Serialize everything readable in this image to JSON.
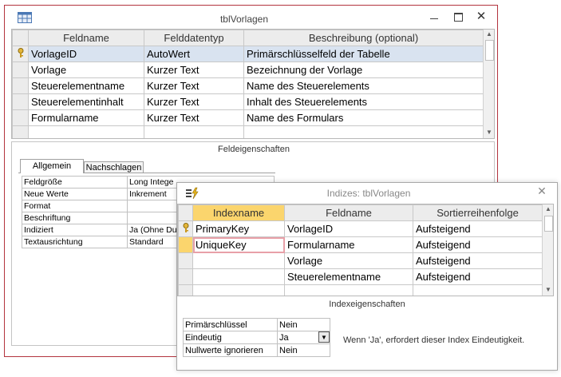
{
  "main": {
    "title": "tblVorlagen",
    "columns": [
      "Feldname",
      "Felddatentyp",
      "Beschreibung (optional)"
    ],
    "rows": [
      {
        "name": "VorlageID",
        "type": "AutoWert",
        "desc": "Primärschlüsselfeld der Tabelle"
      },
      {
        "name": "Vorlage",
        "type": "Kurzer Text",
        "desc": "Bezeichnung der Vorlage"
      },
      {
        "name": "Steuerelementname",
        "type": "Kurzer Text",
        "desc": "Name des Steuerelements"
      },
      {
        "name": "Steuerelementinhalt",
        "type": "Kurzer Text",
        "desc": "Inhalt des Steuerelements"
      },
      {
        "name": "Formularname",
        "type": "Kurzer Text",
        "desc": "Name des Formulars"
      }
    ],
    "field_props_title": "Feldeigenschaften",
    "tabs": [
      "Allgemein",
      "Nachschlagen"
    ],
    "props": [
      {
        "label": "Feldgröße",
        "value": "Long Intege"
      },
      {
        "label": "Neue Werte",
        "value": "Inkrement"
      },
      {
        "label": "Format",
        "value": ""
      },
      {
        "label": "Beschriftung",
        "value": ""
      },
      {
        "label": "Indiziert",
        "value": "Ja (Ohne Du"
      },
      {
        "label": "Textausrichtung",
        "value": "Standard"
      }
    ]
  },
  "index": {
    "title": "Indizes: tblVorlagen",
    "columns": [
      "Indexname",
      "Feldname",
      "Sortierreihenfolge"
    ],
    "rows": [
      {
        "index": "PrimaryKey",
        "field": "VorlageID",
        "order": "Aufsteigend"
      },
      {
        "index": "UniqueKey",
        "field": "Formularname",
        "order": "Aufsteigend"
      },
      {
        "index": "",
        "field": "Vorlage",
        "order": "Aufsteigend"
      },
      {
        "index": "",
        "field": "Steuerelementname",
        "order": "Aufsteigend"
      }
    ],
    "props_title": "Indexeigenschaften",
    "props": [
      {
        "label": "Primärschlüssel",
        "value": "Nein"
      },
      {
        "label": "Eindeutig",
        "value": "Ja"
      },
      {
        "label": "Nullwerte ignorieren",
        "value": "Nein"
      }
    ],
    "hint": "Wenn 'Ja', erfordert dieser Index Eindeutigkeit."
  },
  "icons": {
    "minimize": "minimize-icon",
    "maximize": "maximize-icon",
    "close": "close-icon",
    "table": "table-icon",
    "key": "key-icon",
    "indexes": "indexes-icon"
  },
  "colors": {
    "window_border": "#b3333e",
    "active_header": "#fbd56d"
  }
}
